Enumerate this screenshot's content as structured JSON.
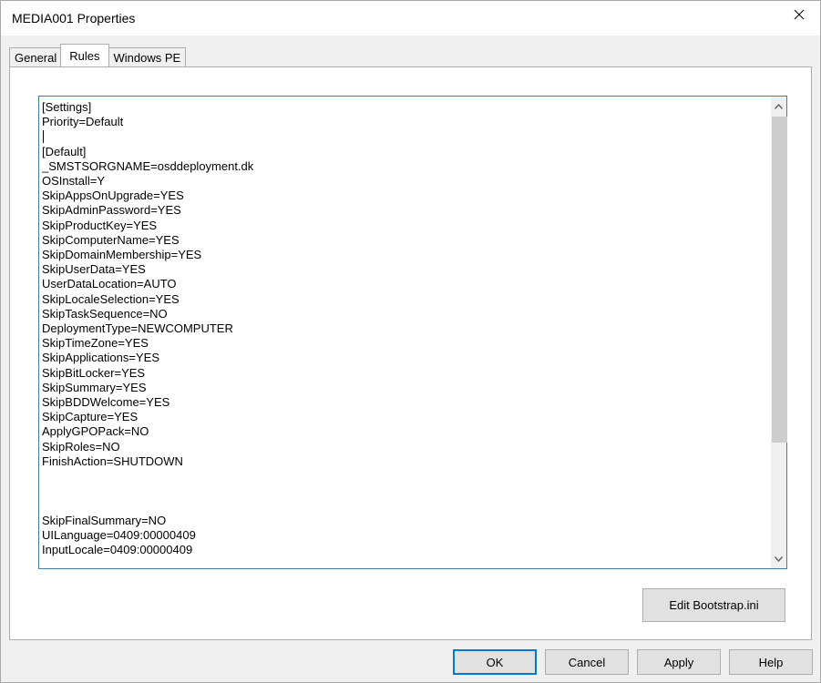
{
  "window": {
    "title": "MEDIA001 Properties"
  },
  "tabs": [
    {
      "label": "General",
      "active": false
    },
    {
      "label": "Rules",
      "active": true
    },
    {
      "label": "Windows PE",
      "active": false
    }
  ],
  "rules": {
    "content": "[Settings]\nPriority=Default\n\n[Default]\n_SMSTSORGNAME=osddeployment.dk\nOSInstall=Y\nSkipAppsOnUpgrade=YES\nSkipAdminPassword=YES\nSkipProductKey=YES\nSkipComputerName=YES\nSkipDomainMembership=YES\nSkipUserData=YES\nUserDataLocation=AUTO\nSkipLocaleSelection=YES\nSkipTaskSequence=NO\nDeploymentType=NEWCOMPUTER\nSkipTimeZone=YES\nSkipApplications=YES\nSkipBitLocker=YES\nSkipSummary=YES\nSkipBDDWelcome=YES\nSkipCapture=YES\nApplyGPOPack=NO\nSkipRoles=NO\nFinishAction=SHUTDOWN\n\n\n\nSkipFinalSummary=NO\nUILanguage=0409:00000409\nInputLocale=0409:00000409"
  },
  "buttons": {
    "edit_bootstrap": "Edit Bootstrap.ini",
    "ok": "OK",
    "cancel": "Cancel",
    "apply": "Apply",
    "help": "Help"
  },
  "icons": {
    "close": "close-icon",
    "scroll_up": "chevron-up-icon",
    "scroll_down": "chevron-down-icon"
  },
  "colors": {
    "accent": "#0078d7",
    "editor_border": "#3c7fb1"
  }
}
